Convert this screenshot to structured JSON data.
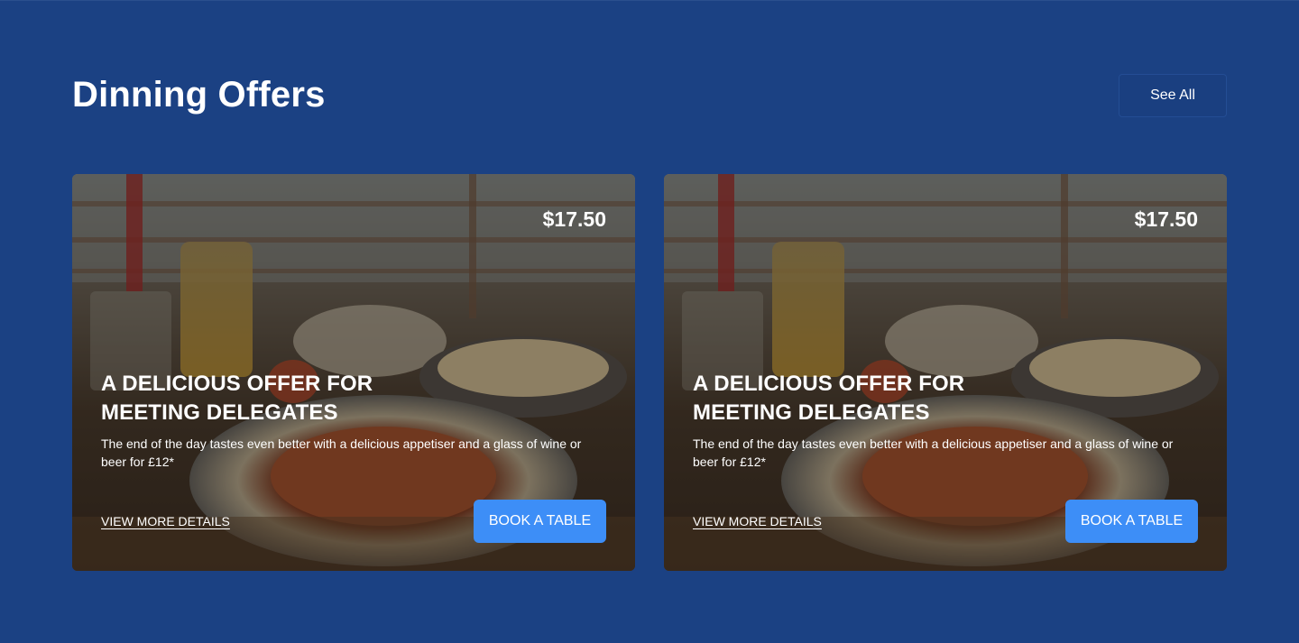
{
  "section": {
    "title": "Dinning Offers",
    "see_all_label": "See All"
  },
  "offers": [
    {
      "price": "$17.50",
      "title": "A DELICIOUS OFFER FOR MEETING DELEGATES",
      "description": "The end of the day tastes even better with a delicious appetiser and a glass of wine or beer for £12*",
      "details_label": "VIEW MORE DETAILS",
      "book_label": "BOOK A TABLE"
    },
    {
      "price": "$17.50",
      "title": "A DELICIOUS OFFER FOR MEETING DELEGATES",
      "description": "The end of the day tastes even better with a delicious appetiser and a glass of wine or beer for £12*",
      "details_label": "VIEW MORE DETAILS",
      "book_label": "BOOK A TABLE"
    }
  ],
  "colors": {
    "page_background": "#1b4183",
    "button_accent": "#3d8ef7",
    "text": "#ffffff"
  }
}
